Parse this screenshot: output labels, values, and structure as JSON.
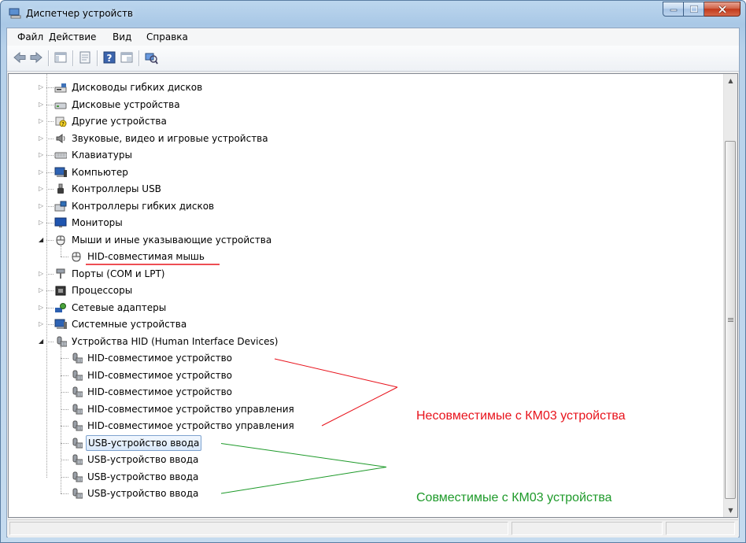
{
  "window": {
    "title": "Диспетчер устройств"
  },
  "menu": [
    "Файл",
    "Действие",
    "Вид",
    "Справка"
  ],
  "toolbar_icons": [
    "back-arrow-icon",
    "forward-arrow-icon",
    "show-hide-console-tree-icon",
    "properties-icon",
    "help-icon",
    "console-tree-view-icon",
    "scan-hardware-icon"
  ],
  "tree": {
    "categories": [
      {
        "label": "Дисководы гибких дисков",
        "icon": "floppy-drive-icon",
        "expanded": false
      },
      {
        "label": "Дисковые устройства",
        "icon": "disk-drive-icon",
        "expanded": false
      },
      {
        "label": "Другие устройства",
        "icon": "unknown-device-icon",
        "expanded": false
      },
      {
        "label": "Звуковые, видео и игровые устройства",
        "icon": "speaker-icon",
        "expanded": false
      },
      {
        "label": "Клавиатуры",
        "icon": "keyboard-icon",
        "expanded": false
      },
      {
        "label": "Компьютер",
        "icon": "computer-icon",
        "expanded": false
      },
      {
        "label": "Контроллеры USB",
        "icon": "usb-plug-icon",
        "expanded": false
      },
      {
        "label": "Контроллеры гибких дисков",
        "icon": "floppy-controller-icon",
        "expanded": false
      },
      {
        "label": "Мониторы",
        "icon": "monitor-icon",
        "expanded": false
      },
      {
        "label": "Мыши и иные указывающие устройства",
        "icon": "mouse-icon",
        "expanded": true,
        "children": [
          {
            "label": "HID-совместимая мышь",
            "icon": "mouse-icon"
          }
        ]
      },
      {
        "label": "Порты (COM и LPT)",
        "icon": "port-icon",
        "expanded": false
      },
      {
        "label": "Процессоры",
        "icon": "processor-icon",
        "expanded": false
      },
      {
        "label": "Сетевые адаптеры",
        "icon": "network-adapter-icon",
        "expanded": false
      },
      {
        "label": "Системные устройства",
        "icon": "system-device-icon",
        "expanded": false
      },
      {
        "label": "Устройства HID (Human Interface Devices)",
        "icon": "hid-device-icon",
        "expanded": true,
        "children": [
          {
            "label": "HID-совместимое устройство",
            "icon": "hid-device-icon"
          },
          {
            "label": "HID-совместимое устройство",
            "icon": "hid-device-icon"
          },
          {
            "label": "HID-совместимое устройство",
            "icon": "hid-device-icon"
          },
          {
            "label": "HID-совместимое устройство управления",
            "icon": "hid-device-icon"
          },
          {
            "label": "HID-совместимое устройство управления",
            "icon": "hid-device-icon"
          },
          {
            "label": "USB-устройство ввода",
            "icon": "hid-device-icon",
            "selected": true
          },
          {
            "label": "USB-устройство ввода",
            "icon": "hid-device-icon"
          },
          {
            "label": "USB-устройство ввода",
            "icon": "hid-device-icon"
          },
          {
            "label": "USB-устройство ввода",
            "icon": "hid-device-icon"
          }
        ]
      }
    ]
  },
  "annotations": {
    "incompatible": {
      "text": "Несовместимые с КМ03 устройства",
      "color": "#e8131c"
    },
    "compatible": {
      "text": "Совместимые с КМ03 устройства",
      "color": "#1e9a2a"
    },
    "underline_color": "#e8131c"
  }
}
